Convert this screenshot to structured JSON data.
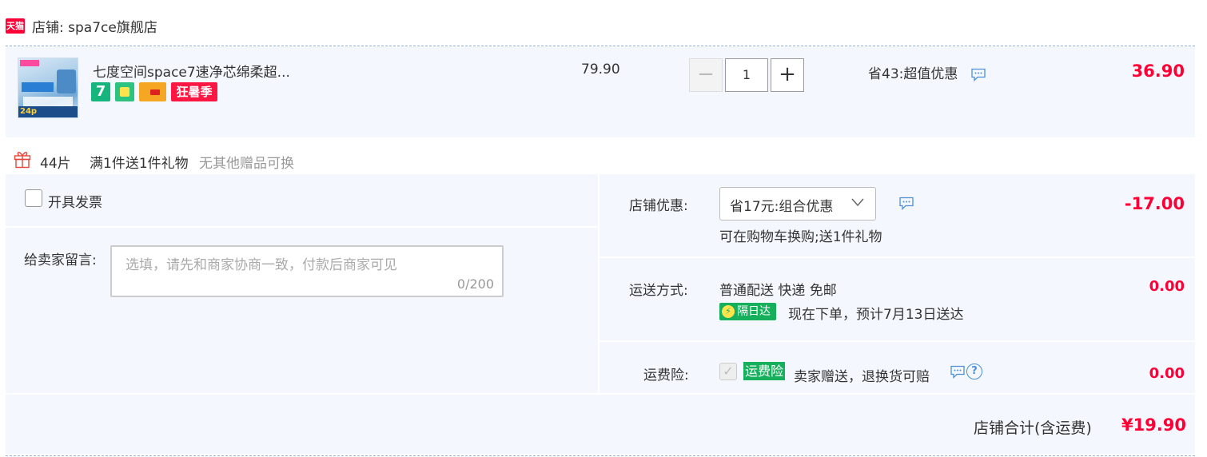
{
  "shop": {
    "badge": "天猫",
    "name": "店铺: spa7ce旗舰店"
  },
  "item": {
    "title": "七度空间space7速净芯绵柔超...",
    "tags": [
      "7",
      "狂暑季"
    ],
    "thumb_labels": [
      "24p"
    ],
    "unit_price": "79.90",
    "quantity": "1",
    "minus_label": "−",
    "plus_label": "+",
    "saving": "省43:超值优惠",
    "subtotal": "36.90"
  },
  "gift": {
    "count": "44片",
    "rule": "满1件送1件礼物",
    "note": "无其他赠品可换"
  },
  "invoice": {
    "label": "开具发票"
  },
  "memo": {
    "label": "给卖家留言:",
    "placeholder": "选填，请先和商家协商一致，付款后商家可见",
    "count": "0/200"
  },
  "promo": {
    "label": "店铺优惠:",
    "selected": "省17元:组合优惠",
    "subtext": "可在购物车换购;送1件礼物",
    "amount": "-17.00"
  },
  "shipping": {
    "label": "运送方式:",
    "method": "普通配送 快递 免邮",
    "badge": "隔日达",
    "eta": "现在下单，预计7月13日送达",
    "amount": "0.00"
  },
  "insurance": {
    "label": "运费险:",
    "badge": "运费险",
    "text": "卖家赠送，退换货可赔",
    "help": "?",
    "amount": "0.00"
  },
  "total": {
    "label": "店铺合计(含运费)",
    "amount": "¥19.90"
  },
  "colors": {
    "accent_red": "#ff0036",
    "panel_bg": "#f4f8fe",
    "green_badge": "#16b05c"
  }
}
